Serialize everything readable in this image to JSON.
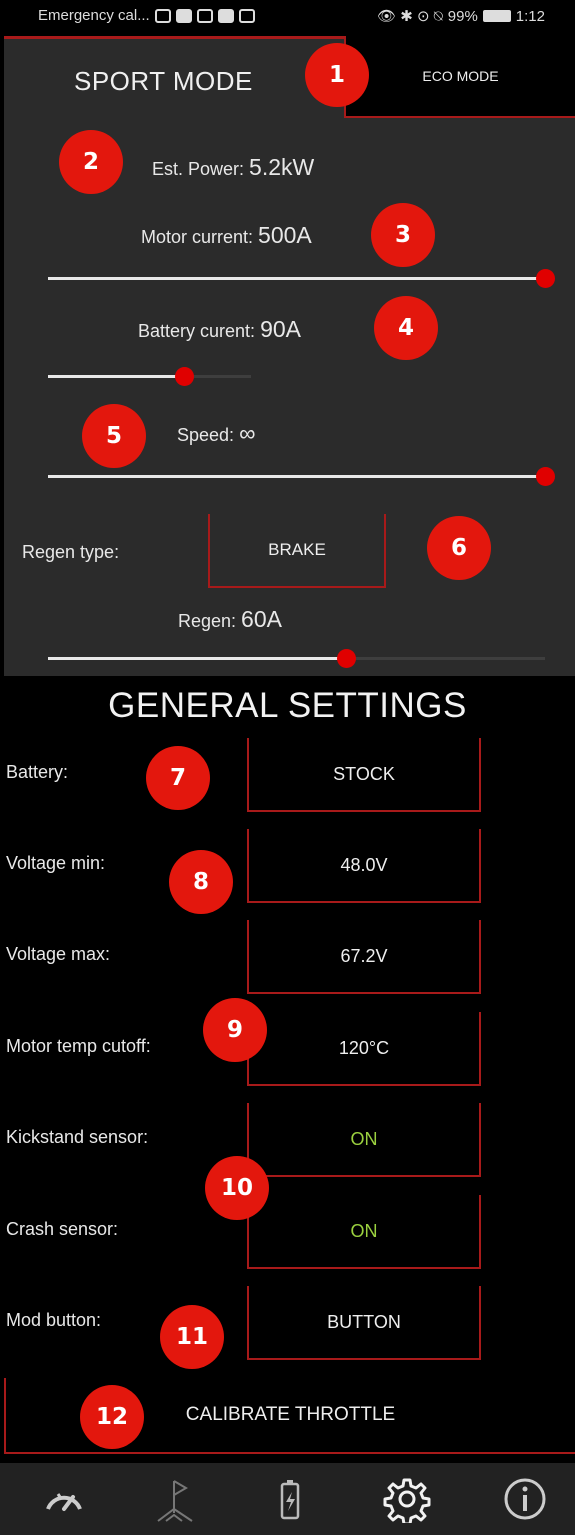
{
  "status_bar": {
    "left_text": "Emergency cal...",
    "right_battery": "99%",
    "time": "1:12"
  },
  "sport": {
    "tab_sport_label": "SPORT MODE",
    "tab_eco_label": "ECO MODE",
    "est_power_label": "Est. Power: ",
    "est_power_value": "5.2kW",
    "motor_current_label": "Motor current: ",
    "motor_current_value": "500A",
    "motor_current_level": 1.0,
    "battery_current_label": "Battery curent: ",
    "battery_current_value": "90A",
    "battery_current_level": 0.67,
    "speed_label": "Speed: ",
    "speed_value": "∞",
    "speed_level": 1.0,
    "regen_type_label": "Regen type:",
    "regen_type_value": "BRAKE",
    "regen_label": "Regen: ",
    "regen_value": "60A",
    "regen_level": 0.6
  },
  "general": {
    "title": "GENERAL SETTINGS",
    "rows": [
      {
        "label": "Battery:",
        "value": "STOCK"
      },
      {
        "label": "Voltage min:",
        "value": "48.0V"
      },
      {
        "label": "Voltage max:",
        "value": "67.2V"
      },
      {
        "label": "Motor temp cutoff:",
        "value": "120°C"
      },
      {
        "label": "Kickstand sensor:",
        "value": "ON"
      },
      {
        "label": "Crash sensor:",
        "value": "ON"
      },
      {
        "label": "Mod button:",
        "value": "BUTTON"
      }
    ],
    "calibrate_label": "CALIBRATE THROTTLE"
  },
  "nav": [
    "speedometer-icon",
    "route-flag-icon",
    "battery-icon",
    "settings-gear-icon",
    "info-icon"
  ],
  "markers": [
    "1",
    "2",
    "3",
    "4",
    "5",
    "6",
    "7",
    "8",
    "9",
    "10",
    "11",
    "12"
  ],
  "colors": {
    "accent_red": "#a81a1a",
    "thumb_red": "#e00000",
    "on_green": "#9bd13f",
    "marker_red": "#e3170d"
  }
}
